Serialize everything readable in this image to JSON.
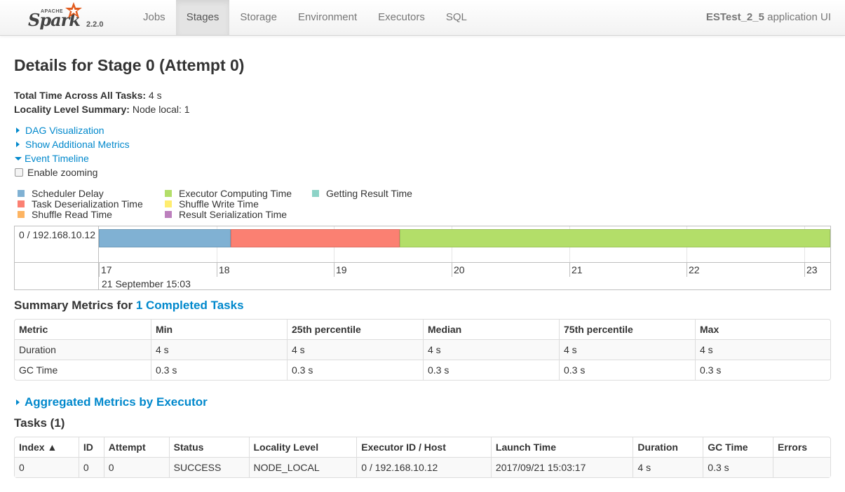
{
  "brand": {
    "apache": "APACHE",
    "name": "Spark",
    "version": "2.2.0"
  },
  "nav": {
    "tabs": [
      "Jobs",
      "Stages",
      "Storage",
      "Environment",
      "Executors",
      "SQL"
    ],
    "active": "Stages",
    "app_name": "ESTest_2_5",
    "app_suffix": " application UI"
  },
  "page": {
    "title": "Details for Stage 0 (Attempt 0)",
    "total_time_label": "Total Time Across All Tasks:",
    "total_time_value": " 4 s",
    "locality_label": "Locality Level Summary:",
    "locality_value": " Node local: 1"
  },
  "expanders": {
    "dag": "DAG Visualization",
    "metrics": "Show Additional Metrics",
    "timeline": "Event Timeline",
    "zoom": "Enable zooming"
  },
  "legend": [
    {
      "label": "Scheduler Delay",
      "color": "#80b1d3"
    },
    {
      "label": "Task Deserialization Time",
      "color": "#fb8072"
    },
    {
      "label": "Shuffle Read Time",
      "color": "#fdb462"
    },
    {
      "label": "Executor Computing Time",
      "color": "#b3de69"
    },
    {
      "label": "Shuffle Write Time",
      "color": "#ffed6f"
    },
    {
      "label": "Result Serialization Time",
      "color": "#bc80bd"
    },
    {
      "label": "Getting Result Time",
      "color": "#8dd3c7"
    }
  ],
  "timeline": {
    "row_label": "0 / 192.168.10.12",
    "ticks": [
      "17",
      "18",
      "19",
      "20",
      "21",
      "22",
      "23"
    ],
    "date_label": "21 September 15:03",
    "tick_seconds": [
      17,
      18,
      19,
      20,
      21,
      22,
      23
    ],
    "view_start": 17.0,
    "view_end": 23.22,
    "segments": [
      {
        "phase": "Scheduler Delay",
        "start": 17.0,
        "end": 18.12,
        "color": "#80b1d3"
      },
      {
        "phase": "Task Deserialization Time",
        "start": 18.12,
        "end": 19.56,
        "color": "#fb8072"
      },
      {
        "phase": "Executor Computing Time",
        "start": 19.56,
        "end": 23.22,
        "color": "#b3de69"
      }
    ]
  },
  "summary": {
    "heading_prefix": "Summary Metrics for ",
    "heading_link": "1 Completed Tasks",
    "columns": [
      "Metric",
      "Min",
      "25th percentile",
      "Median",
      "75th percentile",
      "Max"
    ],
    "rows": [
      [
        "Duration",
        "4 s",
        "4 s",
        "4 s",
        "4 s",
        "4 s"
      ],
      [
        "GC Time",
        "0.3 s",
        "0.3 s",
        "0.3 s",
        "0.3 s",
        "0.3 s"
      ]
    ]
  },
  "aggregated": {
    "label": "Aggregated Metrics by Executor"
  },
  "tasks": {
    "heading": "Tasks (1)",
    "columns": [
      "Index ▲",
      "ID",
      "Attempt",
      "Status",
      "Locality Level",
      "Executor ID / Host",
      "Launch Time",
      "Duration",
      "GC Time",
      "Errors"
    ],
    "rows": [
      [
        "0",
        "0",
        "0",
        "SUCCESS",
        "NODE_LOCAL",
        "0 / 192.168.10.12",
        "2017/09/21 15:03:17",
        "4 s",
        "0.3 s",
        ""
      ]
    ]
  }
}
